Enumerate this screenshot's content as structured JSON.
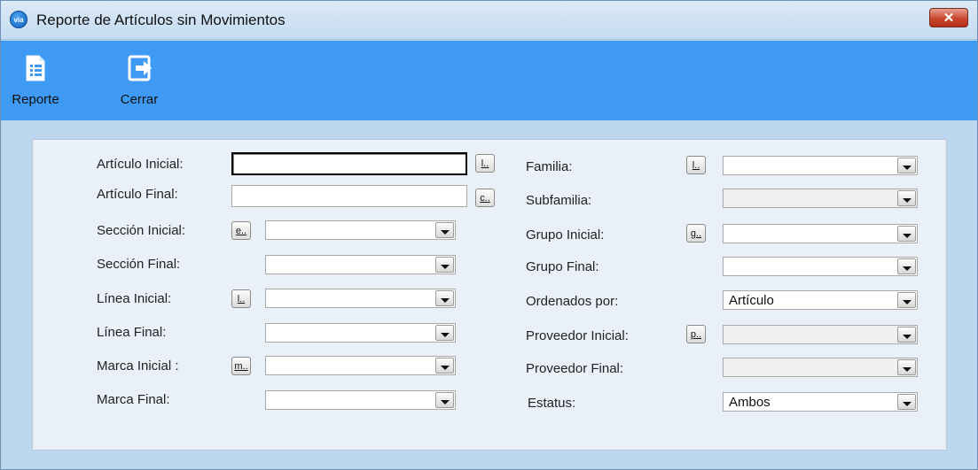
{
  "window": {
    "title": "Reporte de Artículos sin Movimientos",
    "close_label": "✕",
    "app_icon_text": "via"
  },
  "toolbar": {
    "report_label": "Reporte",
    "close_label": "Cerrar"
  },
  "left": {
    "articulo_inicial": {
      "label": "Artículo Inicial:",
      "value": "",
      "btn": "l.."
    },
    "articulo_final": {
      "label": "Artículo Final:",
      "value": "",
      "btn": "c.."
    },
    "seccion_inicial": {
      "label": "Sección Inicial:",
      "btn": "e..",
      "value": ""
    },
    "seccion_final": {
      "label": "Sección Final:",
      "value": ""
    },
    "linea_inicial": {
      "label": "Línea Inicial:",
      "btn": "l..",
      "value": ""
    },
    "linea_final": {
      "label": "Línea Final:",
      "value": ""
    },
    "marca_inicial": {
      "label": "Marca Inicial :",
      "btn": "m..",
      "value": ""
    },
    "marca_final": {
      "label": "Marca Final:",
      "value": ""
    }
  },
  "right": {
    "familia": {
      "label": "Familia:",
      "btn": "l..",
      "value": ""
    },
    "subfamilia": {
      "label": "Subfamilia:",
      "value": ""
    },
    "grupo_inicial": {
      "label": "Grupo Inicial:",
      "btn": "g..",
      "value": ""
    },
    "grupo_final": {
      "label": "Grupo Final:",
      "value": ""
    },
    "ordenados_por": {
      "label": "Ordenados por:",
      "value": "Artículo"
    },
    "proveedor_inicial": {
      "label": "Proveedor Inicial:",
      "btn": "p..",
      "value": ""
    },
    "proveedor_final": {
      "label": "Proveedor Final:",
      "value": ""
    },
    "estatus": {
      "label": "Estatus:",
      "value": "Ambos"
    }
  }
}
